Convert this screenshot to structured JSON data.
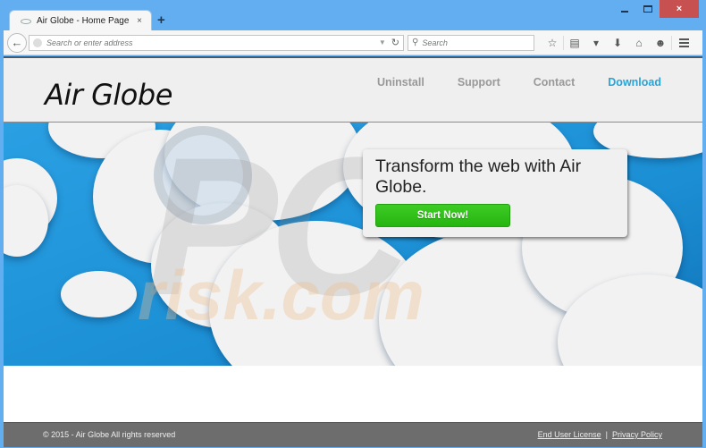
{
  "browser": {
    "tab_title": "Air Globe - Home Page",
    "new_tab_label": "+",
    "close_tab_label": "×",
    "url_placeholder": "Search or enter address",
    "search_placeholder": "Search",
    "window_controls": {
      "close_label": "×"
    }
  },
  "site": {
    "logo": "Air Globe",
    "nav": [
      {
        "label": "Uninstall",
        "active": false
      },
      {
        "label": "Support",
        "active": false
      },
      {
        "label": "Contact",
        "active": false
      },
      {
        "label": "Download",
        "active": true
      }
    ],
    "hero": {
      "headline": "Transform the web with Air Globe.",
      "cta_label": "Start Now!",
      "watermark_top": "PC",
      "watermark_bottom": "risk.com"
    },
    "footer": {
      "copyright": "© 2015 - Air Globe All rights reserved",
      "links": [
        "End User License",
        "Privacy Policy"
      ],
      "separator": "|"
    }
  },
  "colors": {
    "accent": "#28a4d9",
    "cta_green": "#2fbf17",
    "sky_blue": "#1f95d9",
    "footer_bg": "#6d6d6d",
    "titlebar": "#62aef0"
  }
}
